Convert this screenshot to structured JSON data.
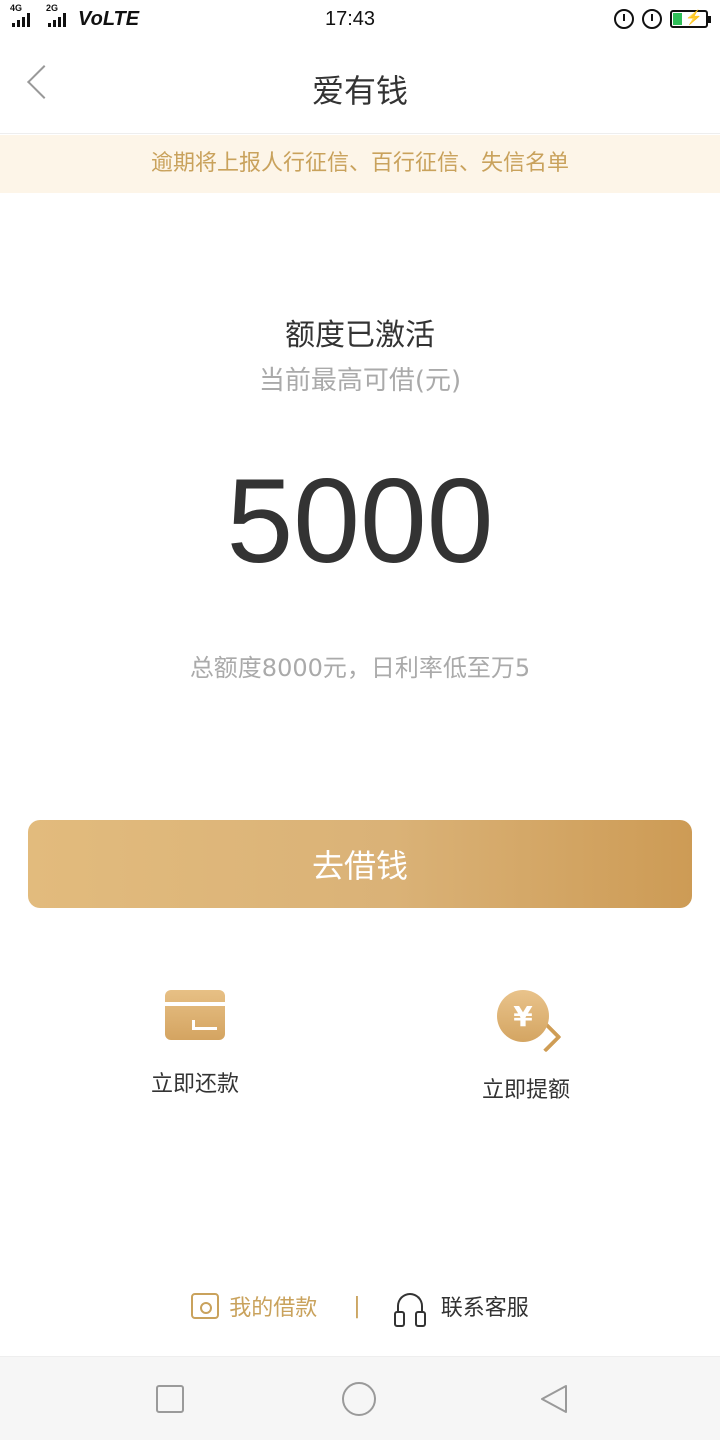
{
  "status_bar": {
    "network_1": "4G",
    "network_2": "2G",
    "volte": "VoLTE",
    "time": "17:43"
  },
  "header": {
    "title": "爱有钱"
  },
  "notice": {
    "text": "逾期将上报人行征信、百行征信、失信名单"
  },
  "main": {
    "status": "额度已激活",
    "subtitle": "当前最高可借(元)",
    "amount": "5000",
    "credit_info": "总额度8000元，日利率低至万5",
    "borrow_button": "去借钱"
  },
  "actions": {
    "repay_label": "立即还款",
    "raise_label": "立即提额",
    "coin_symbol": "¥"
  },
  "bottom": {
    "my_loans": "我的借款",
    "divider": "|",
    "customer_service": "联系客服"
  },
  "colors": {
    "accent_gold": "#c9a25c",
    "button_gradient_start": "#e2bb7d",
    "button_gradient_end": "#cd9b55",
    "notice_bg": "#fdf5e8"
  }
}
